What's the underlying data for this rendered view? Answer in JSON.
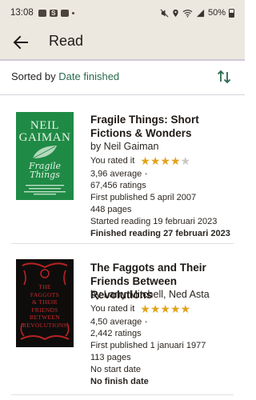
{
  "status_bar": {
    "time": "13:08",
    "battery": "50%",
    "notif_letter": "S"
  },
  "app_bar": {
    "title": "Read",
    "back_icon": "arrow-left-icon"
  },
  "sort": {
    "prefix": "Sorted by",
    "value": "Date finished",
    "toggle_icon": "sort-direction-icon"
  },
  "colors": {
    "accent_green": "#2a6a4e",
    "star_filled": "#e3a21a",
    "star_empty": "#c9c6c4",
    "bar_background": "#ece8e0"
  },
  "books": [
    {
      "title": "Fragile Things: Short Fictions & Wonders",
      "author": "by Neil Gaiman",
      "rated_label": "You rated it",
      "user_rating": 4,
      "max_rating": 5,
      "average": "3,96 average",
      "ratings": "67,456 ratings",
      "first_published": "First published 5 april 2007",
      "pages": "448 pages",
      "started": "Started reading 19 februari 2023",
      "finished": "Finished reading 27 februari 2023",
      "cover": {
        "author_line1": "NEIL",
        "author_line2": "GAIMAN",
        "title_line1": "Fragile",
        "title_line2": "Things"
      }
    },
    {
      "title": "The Faggots and Their Friends Between Revolutions",
      "author": "by Larry Mitchell, Ned Asta",
      "rated_label": "You rated it",
      "user_rating": 5,
      "max_rating": 5,
      "average": "4,50 average",
      "ratings": "2,442 ratings",
      "first_published": "First published 1 januari 1977",
      "pages": "113 pages",
      "started": "No start date",
      "finished": "No finish date",
      "cover": {
        "line1": "THE",
        "line2": "FAGGOTS",
        "line3": "& THEIR",
        "line4": "FRIENDS",
        "line5": "BETWEEN",
        "line6": "REVOLUTIONS"
      }
    }
  ]
}
